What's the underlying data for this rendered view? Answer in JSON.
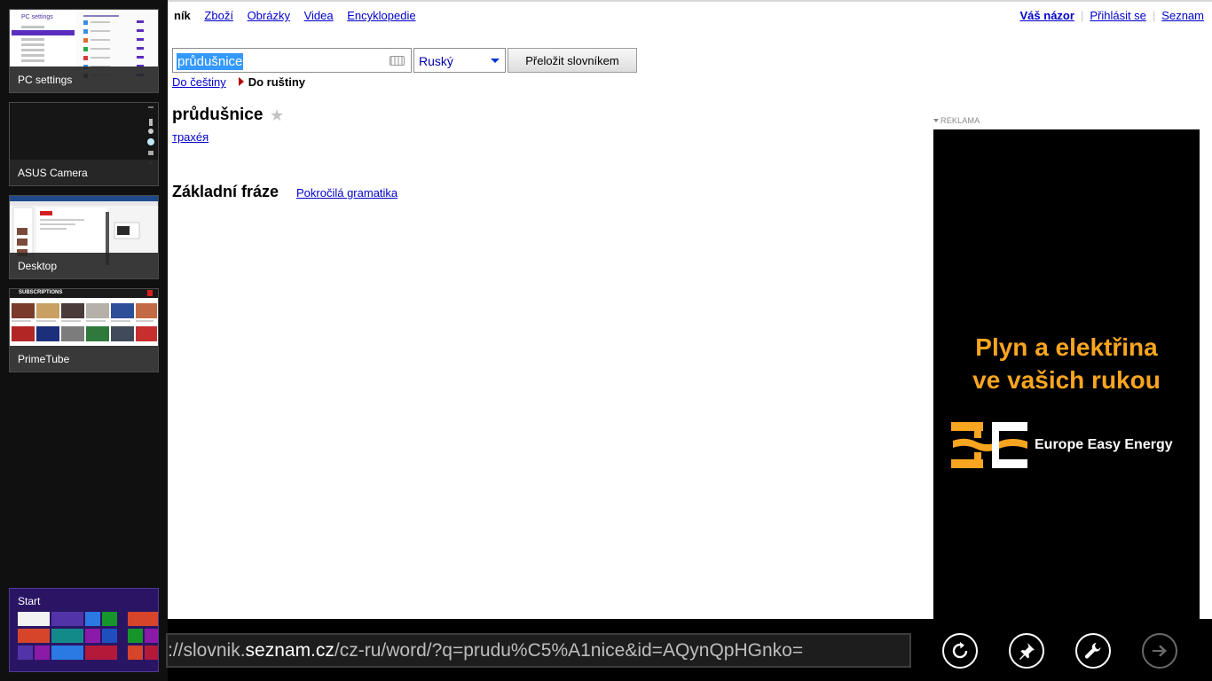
{
  "nav": {
    "left_fragment": "ník",
    "items": [
      "Zboží",
      "Obrázky",
      "Videa",
      "Encyklopedie"
    ],
    "right": [
      "Váš názor",
      "Přihlásit se",
      "Seznam"
    ]
  },
  "search": {
    "query": "průdušnice",
    "language": "Ruský",
    "translate_label": "Přeložit slovníkem"
  },
  "direction": {
    "to_czech": "Do češtiny",
    "to_russian": "Do ruštiny"
  },
  "entry": {
    "headword": "průdušnice",
    "translation": "трахéя"
  },
  "sections": {
    "phrases": "Základní fráze",
    "grammar": "Pokročilá gramatika"
  },
  "ad": {
    "label": "REKLAMA",
    "headline_1": "Plyn a elektřina",
    "headline_2": "ve vašich rukou",
    "brand": "Europe Easy Energy",
    "accent_color": "#f9a520"
  },
  "switcher": {
    "apps": [
      {
        "name": "PC settings"
      },
      {
        "name": "ASUS Camera"
      },
      {
        "name": "Desktop"
      },
      {
        "name": "PrimeTube"
      }
    ],
    "start": "Start",
    "pc_settings_title": "PC settings",
    "primetube_header": "SUBSCRIPTIONS"
  },
  "appbar": {
    "url_prefix": "://slovnik.",
    "url_host": "seznam.cz",
    "url_path": "/cz-ru/word/?q=prudu%C5%A1nice&id=AQynQpHGnko=",
    "buttons": [
      "refresh-icon",
      "pin-icon",
      "settings-wrench-icon",
      "forward-arrow-icon"
    ]
  }
}
